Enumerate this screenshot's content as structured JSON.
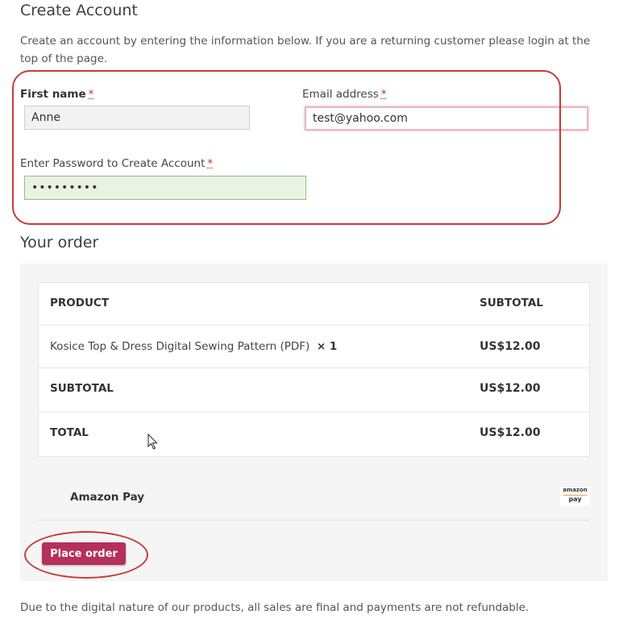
{
  "create_account": {
    "title": "Create Account",
    "intro": "Create an account by entering the information below. If you are a returning customer please login at the top of the page.",
    "first_name_label": "First name",
    "first_name_value": "Anne",
    "email_label": "Email address",
    "email_value": "test@yahoo.com",
    "password_label": "Enter Password to Create Account",
    "password_value": "•••••••••",
    "required_mark": "*"
  },
  "order": {
    "title": "Your order",
    "header_product": "PRODUCT",
    "header_subtotal": "SUBTOTAL",
    "item_name": "Kosice Top & Dress Digital Sewing Pattern (PDF)",
    "item_qty": "× 1",
    "item_price": "US$12.00",
    "subtotal_label": "SUBTOTAL",
    "subtotal_value": "US$12.00",
    "total_label": "TOTAL",
    "total_value": "US$12.00"
  },
  "payment": {
    "method_label": "Amazon Pay",
    "logo_text_top": "amazon",
    "logo_text_bottom": "pay",
    "place_order_label": "Place order"
  },
  "footer": {
    "notice": "Due to the digital nature of our products, all sales are final and payments are not refundable."
  },
  "colors": {
    "accent": "#b5305a",
    "annotation": "#c83a3a",
    "valid_field": "#eaf3e3"
  }
}
